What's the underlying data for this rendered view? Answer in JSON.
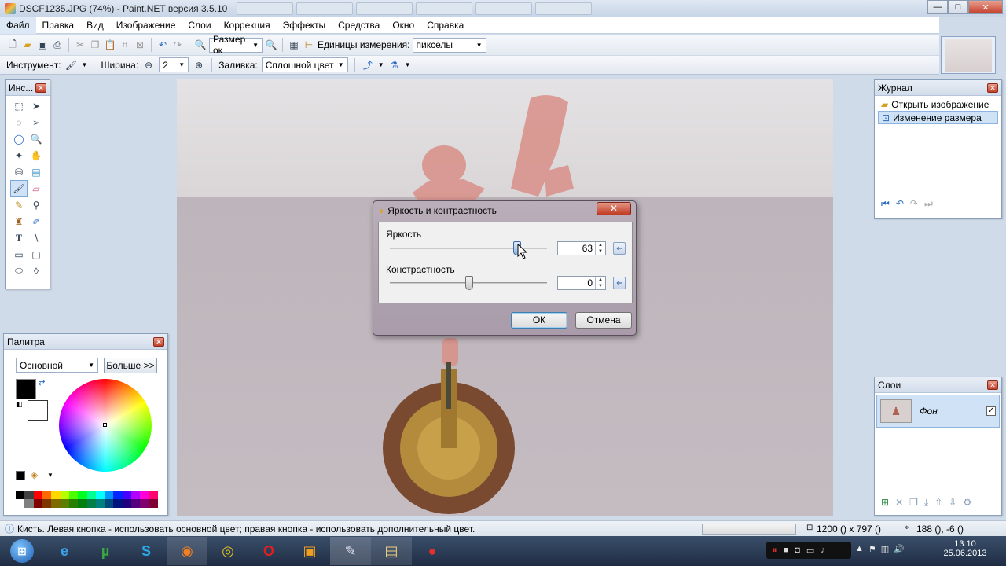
{
  "window": {
    "title": "DSCF1235.JPG (74%) - Paint.NET версия 3.5.10"
  },
  "menu": [
    "Файл",
    "Правка",
    "Вид",
    "Изображение",
    "Слои",
    "Коррекция",
    "Эффекты",
    "Средства",
    "Окно",
    "Справка"
  ],
  "toolbar1": {
    "zoom_value": "Размер ок",
    "units_label": "Единицы измерения:",
    "units_value": "пикселы"
  },
  "toolbar2": {
    "tool_label": "Инструмент:",
    "width_label": "Ширина:",
    "width_value": "2",
    "fill_label": "Заливка:",
    "fill_value": "Сплошной цвет"
  },
  "tools_panel": {
    "title": "Инс..."
  },
  "history_panel": {
    "title": "Журнал",
    "items": [
      "Открыть изображение",
      "Изменение размера"
    ]
  },
  "palette_panel": {
    "title": "Палитра",
    "mode": "Основной",
    "more_button": "Больше >>"
  },
  "layers_panel": {
    "title": "Слои",
    "layer_name": "Фон"
  },
  "dialog": {
    "title": "Яркость и контрастность",
    "brightness_label": "Яркость",
    "brightness_value": "63",
    "contrast_label": "Констрастность",
    "contrast_value": "0",
    "ok": "ОК",
    "cancel": "Отмена"
  },
  "status": {
    "hint": "Кисть. Левая кнопка - использовать основной цвет; правая кнопка - использовать дополнительный цвет.",
    "image_size": "1200 () x 797 ()",
    "cursor_pos": "188 (), -6 ()"
  },
  "taskbar": {
    "time": "13:10",
    "date": "25.06.2013"
  },
  "colors": {
    "accent": "#3a78c4",
    "dialog_frame": "#b0a2b0",
    "taskbar": "#1f2d44"
  }
}
